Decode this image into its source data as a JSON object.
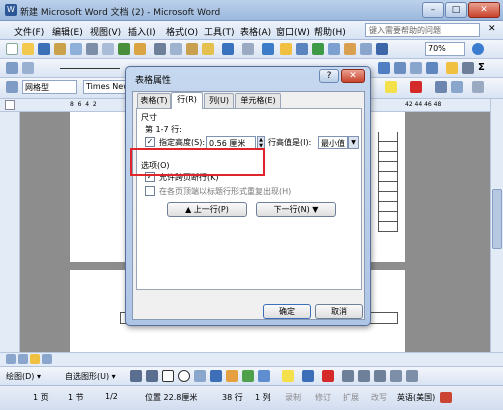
{
  "window": {
    "title": "新建 Microsoft Word 文档 (2) - Microsoft Word",
    "minimize": "–",
    "maximize": "□",
    "close": "✕"
  },
  "menubar": {
    "items": [
      "文件(F)",
      "编辑(E)",
      "视图(V)",
      "插入(I)",
      "格式(O)",
      "工具(T)",
      "表格(A)",
      "窗口(W)",
      "帮助(H)"
    ],
    "help_placeholder": "键入需要帮助的问题",
    "help_close": "✕"
  },
  "toolbar": {
    "zoom": "70%",
    "style": "网格型",
    "font": "Times New",
    "ruler_left": "8  6  4  2",
    "ruler_right": "42 44 46 48"
  },
  "dialog": {
    "title": "表格属性",
    "help": "?",
    "close": "✕",
    "tabs": [
      "表格(T)",
      "行(R)",
      "列(U)",
      "单元格(E)"
    ],
    "size_group": "尺寸",
    "rows_label": "第 1-7 行:",
    "specify_height_label": "指定高度(S):",
    "height_value": "0.56 厘米",
    "height_is_label": "行高值是(I):",
    "height_mode": "最小值",
    "options_group": "选项(O)",
    "allow_break_label": "允许跨页断行(K)",
    "repeat_header_label": "在各页顶端以标题行形式重复出现(H)",
    "prev_row": "▲ 上一行(P)",
    "next_row": "下一行(N) ▼",
    "ok": "确定",
    "cancel": "取消"
  },
  "drawing_toolbar": {
    "draw": "绘图(D) ▾",
    "autoshapes": "自选图形(U) ▾"
  },
  "statusbar": {
    "page": "1 页",
    "section": "1 节",
    "pages": "1/2",
    "position": "位置 22.8厘米",
    "line": "38 行",
    "column": "1 列",
    "rec": "录制",
    "trk": "修订",
    "ext": "扩展",
    "ovr": "改写",
    "language": "英语(美国)"
  }
}
